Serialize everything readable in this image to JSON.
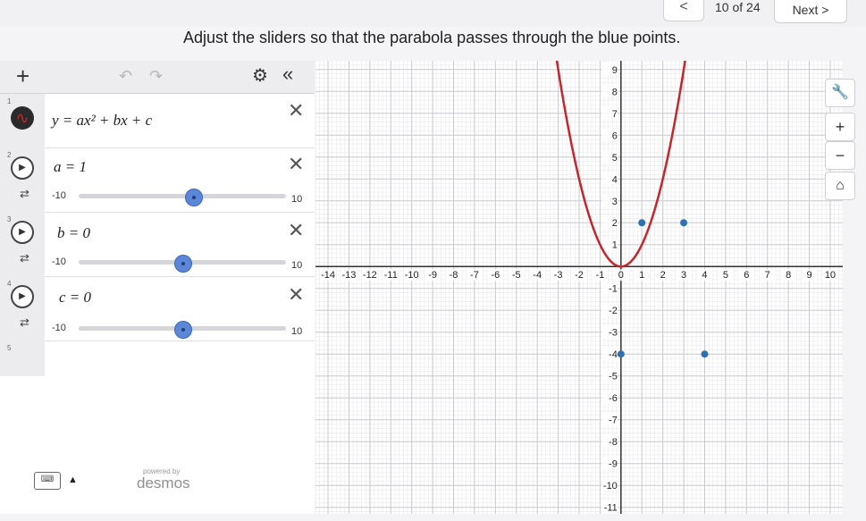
{
  "topbar": {
    "prev_label": "<",
    "progress": "10 of 24",
    "next_label": "Next >"
  },
  "prompt": "Adjust the sliders so that the parabola passes through the blue points.",
  "toolbar": {
    "plus_icon": "+",
    "undo_icon": "undo-arrow",
    "redo_icon": "redo-arrow",
    "settings_icon": "gear",
    "collapse_icon": "double-chevron-left"
  },
  "expressions": {
    "eq": {
      "index": "1",
      "latex_text": "y = ax² + bx + c"
    },
    "a": {
      "index": "2",
      "text": "a = 1",
      "min": "-10",
      "max": "10",
      "value": 1
    },
    "b": {
      "index": "3",
      "text": "b = 0",
      "min": "-10",
      "max": "10",
      "value": 0
    },
    "c": {
      "index": "4",
      "text": "c = 0",
      "min": "-10",
      "max": "10",
      "value": 0
    },
    "empty": {
      "index": "5"
    }
  },
  "footer": {
    "powered_by": "powered by",
    "brand": "desmos"
  },
  "graph_controls": {
    "wrench": "wrench",
    "zoom_in": "+",
    "zoom_out": "−",
    "home": "home"
  },
  "graph": {
    "x_range": [
      -14.6,
      10.6
    ],
    "y_range": [
      -11.3,
      9.4
    ],
    "x_ticks": [
      "-14",
      "-13",
      "-12",
      "-11",
      "-10",
      "-9",
      "-8",
      "-7",
      "-6",
      "-5",
      "-4",
      "-3",
      "-2",
      "-1",
      "0",
      "1",
      "2",
      "3",
      "4",
      "5",
      "6",
      "7",
      "8",
      "9",
      "10"
    ],
    "y_ticks": [
      "9",
      "8",
      "7",
      "6",
      "5",
      "4",
      "3",
      "2",
      "1",
      "-1",
      "-2",
      "-3",
      "-4",
      "-5",
      "-6",
      "-7",
      "-8",
      "-9",
      "-10",
      "-11"
    ],
    "curve": {
      "a": 1,
      "b": 0,
      "c": 0,
      "color": "#c1272d"
    },
    "points": [
      {
        "x": 1,
        "y": 2
      },
      {
        "x": 3,
        "y": 2
      },
      {
        "x": 0,
        "y": -4
      },
      {
        "x": 4,
        "y": -4
      }
    ],
    "point_color": "#2d70b3"
  }
}
